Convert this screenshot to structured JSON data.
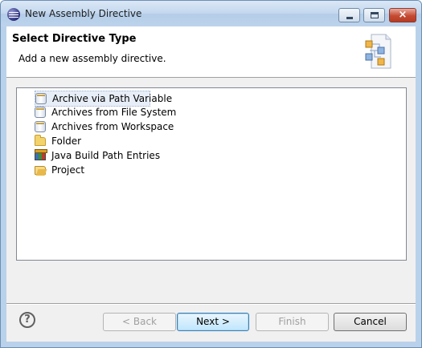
{
  "window": {
    "title": "New Assembly Directive",
    "controls": {
      "minimize": "minimize",
      "maximize": "maximize",
      "close": "×"
    }
  },
  "header": {
    "title": "Select Directive Type",
    "description": "Add a new assembly directive."
  },
  "tree": {
    "items": [
      {
        "label": "Archive via Path Variable",
        "icon": "jar-icon",
        "selected": true
      },
      {
        "label": "Archives from File System",
        "icon": "jar-icon",
        "selected": false
      },
      {
        "label": "Archives from Workspace",
        "icon": "jar-icon",
        "selected": false
      },
      {
        "label": "Folder",
        "icon": "folder-icon",
        "selected": false
      },
      {
        "label": "Java Build Path Entries",
        "icon": "library-icon",
        "selected": false
      },
      {
        "label": "Project",
        "icon": "project-icon",
        "selected": false
      }
    ]
  },
  "footer": {
    "help": "?",
    "back": "< Back",
    "next": "Next >",
    "finish": "Finish",
    "cancel": "Cancel"
  }
}
